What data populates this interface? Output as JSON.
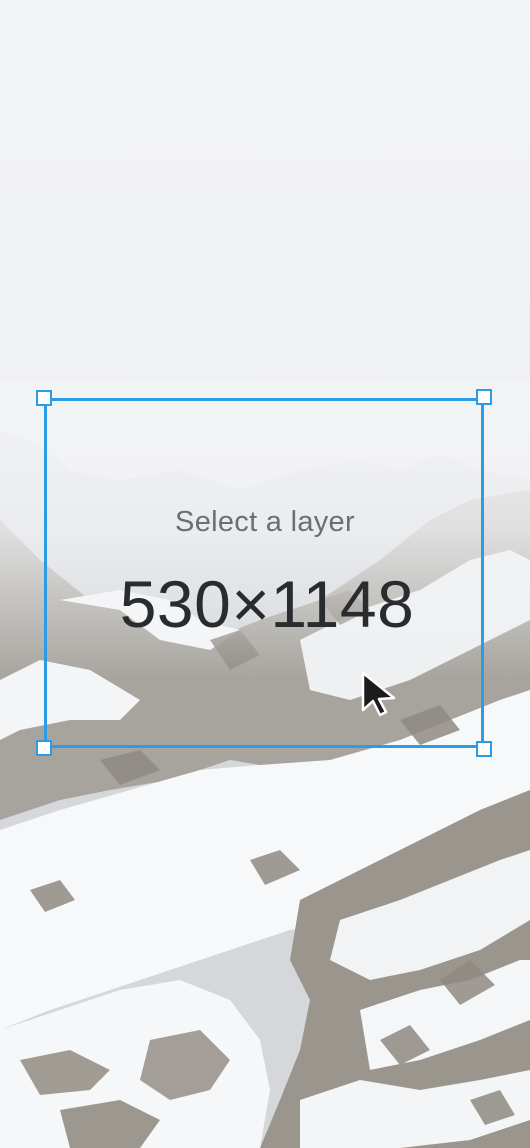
{
  "canvas": {
    "background_description": "snowy rocky mountain slope under foggy white sky",
    "selection_color": "#2d9ce8"
  },
  "overlay": {
    "hint": "Select a layer",
    "dimensions": "530×1148"
  },
  "icons": {
    "cursor": "arrow-pointer-icon"
  }
}
